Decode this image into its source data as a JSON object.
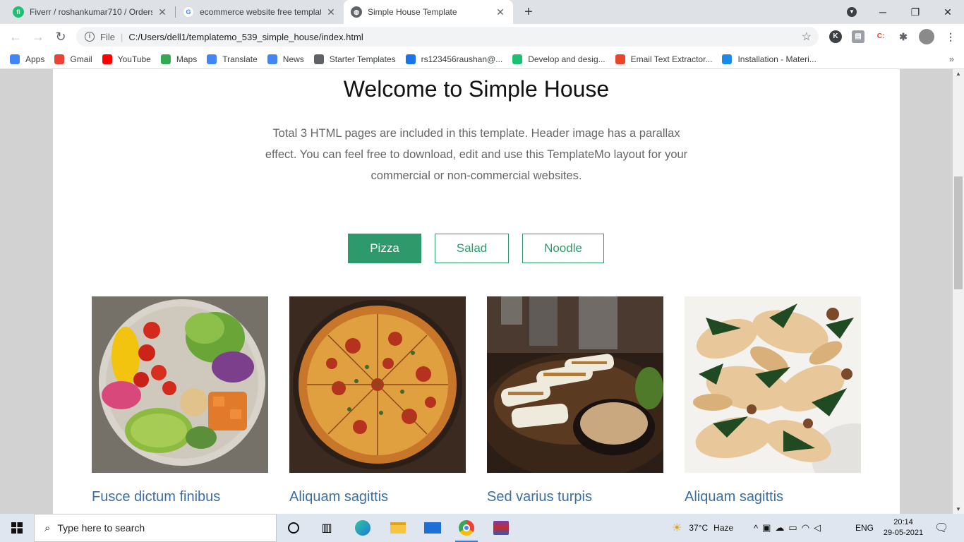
{
  "browser": {
    "tabs": [
      {
        "title": "Fiverr / roshankumar710 / Orders",
        "icon": "fiverr-icon"
      },
      {
        "title": "ecommerce website free template",
        "icon": "google-icon"
      },
      {
        "title": "Simple House Template",
        "icon": "globe-icon",
        "active": true
      }
    ],
    "address": {
      "scheme": "File",
      "url": "C:/Users/dell1/templatemo_539_simple_house/index.html"
    },
    "bookmarks": [
      {
        "label": "Apps",
        "icon": "apps-grid-icon",
        "color": "#4285f4"
      },
      {
        "label": "Gmail",
        "icon": "gmail-icon",
        "color": "#ea4335"
      },
      {
        "label": "YouTube",
        "icon": "youtube-icon",
        "color": "#ff0000"
      },
      {
        "label": "Maps",
        "icon": "maps-icon",
        "color": "#34a853"
      },
      {
        "label": "Translate",
        "icon": "translate-icon",
        "color": "#4285f4"
      },
      {
        "label": "News",
        "icon": "news-icon",
        "color": "#4285f4"
      },
      {
        "label": "Starter Templates",
        "icon": "globe-icon",
        "color": "#5f6368"
      },
      {
        "label": "rs123456raushan@...",
        "icon": "sync-icon",
        "color": "#1a73e8"
      },
      {
        "label": "Develop and desig...",
        "icon": "fiverr-icon",
        "color": "#1dbf73"
      },
      {
        "label": "Email Text Extractor...",
        "icon": "extractor-icon",
        "color": "#e8452c"
      },
      {
        "label": "Installation - Materi...",
        "icon": "material-icon",
        "color": "#1e88e5"
      }
    ]
  },
  "page": {
    "heading": "Welcome to Simple House",
    "intro": "Total 3 HTML pages are included in this template. Header image has a parallax effect. You can feel free to download, edit and use this TemplateMo layout for your commercial or non-commercial websites.",
    "filters": [
      {
        "label": "Pizza",
        "active": true
      },
      {
        "label": "Salad",
        "active": false
      },
      {
        "label": "Noodle",
        "active": false
      }
    ],
    "items": [
      {
        "name": "Fusce dictum finibus",
        "image": "salad-bowl-image"
      },
      {
        "name": "Aliquam sagittis",
        "image": "pizza-image"
      },
      {
        "name": "Sed varius turpis",
        "image": "grilled-fish-image"
      },
      {
        "name": "Aliquam sagittis",
        "image": "pasta-image"
      }
    ],
    "accent_color": "#2e9a6b",
    "title_color": "#3a6ea5"
  },
  "taskbar": {
    "search_placeholder": "Type here to search",
    "weather": {
      "temp": "37°C",
      "condition": "Haze"
    },
    "language": "ENG",
    "time": "20:14",
    "date": "29-05-2021"
  }
}
